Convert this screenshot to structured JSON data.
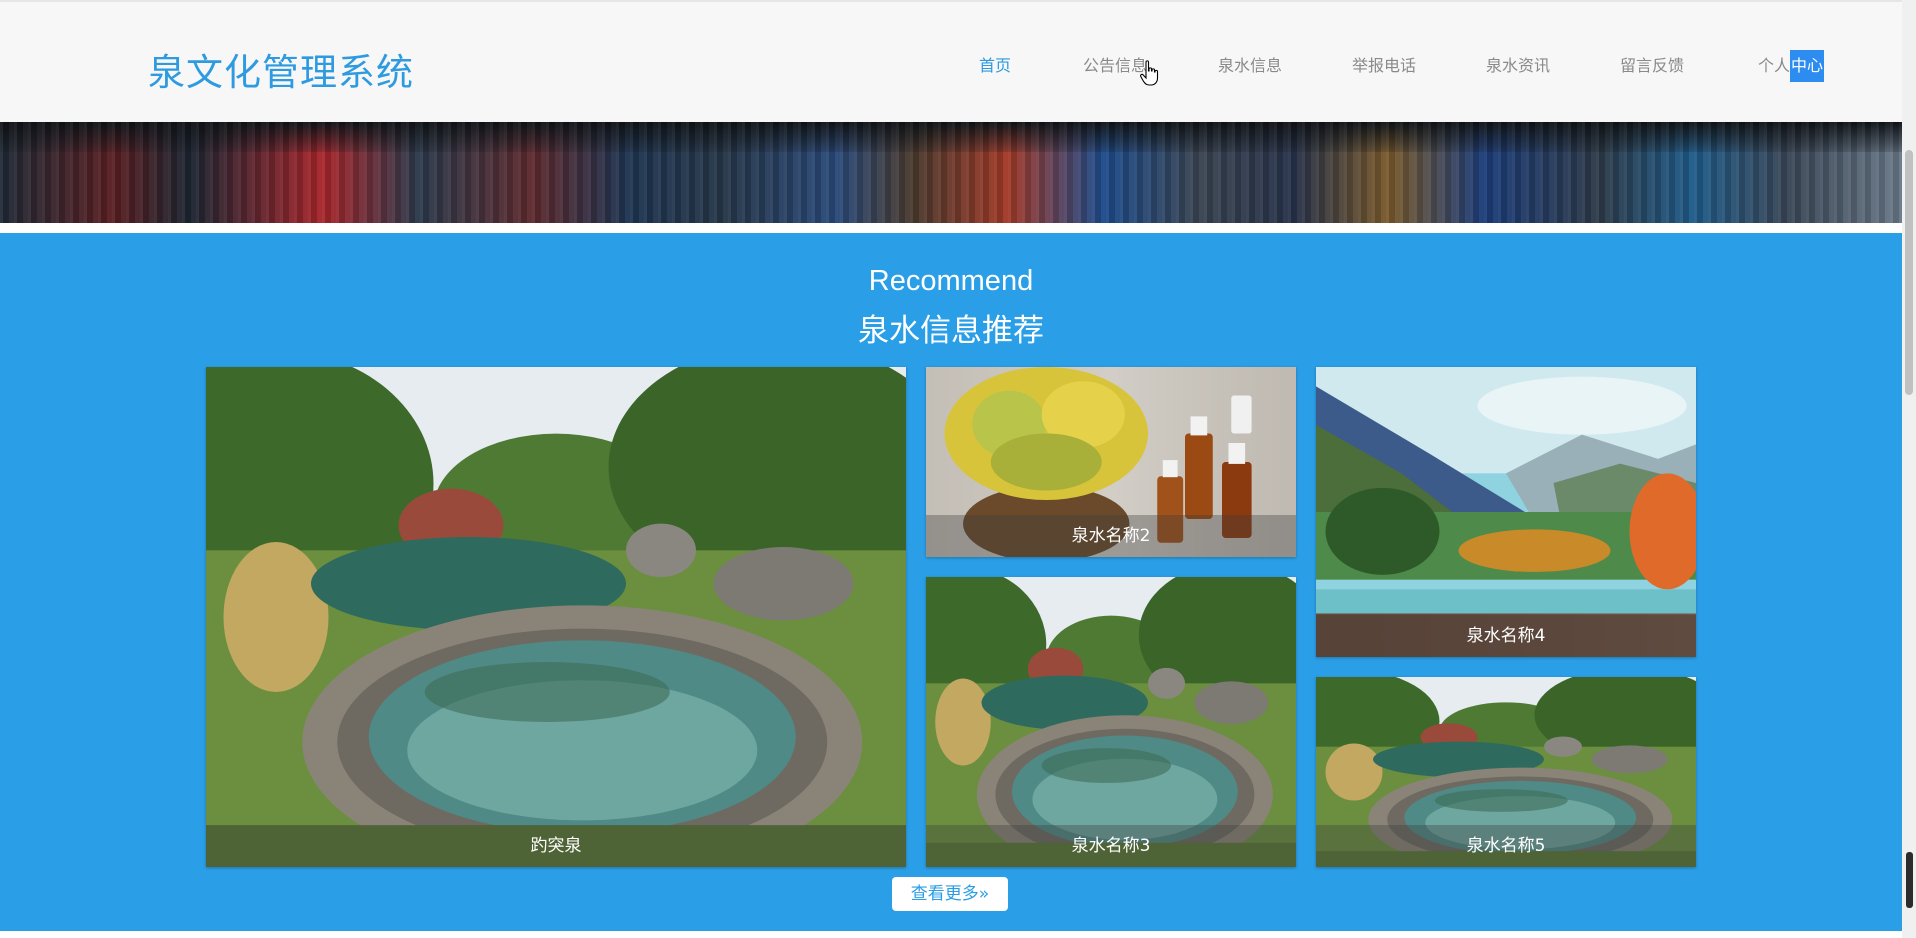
{
  "header": {
    "title": "泉文化管理系统",
    "nav": [
      {
        "label": "首页",
        "active": true
      },
      {
        "label": "公告信息"
      },
      {
        "label": "泉水信息"
      },
      {
        "label": "举报电话"
      },
      {
        "label": "泉水资讯"
      },
      {
        "label": "留言反馈"
      }
    ],
    "personal_prefix": "个人",
    "personal_highlight": "中心"
  },
  "recommend": {
    "title_en": "Recommend",
    "title_cn": "泉水信息推荐",
    "items": [
      {
        "name": "趵突泉",
        "image": "hot-spring-pool"
      },
      {
        "name": "泉水名称2",
        "image": "flower-basket-oil-bottles"
      },
      {
        "name": "泉水名称3",
        "image": "hot-spring-pool"
      },
      {
        "name": "泉水名称4",
        "image": "mountain-infinity-pool"
      },
      {
        "name": "泉水名称5",
        "image": "hot-spring-pool"
      }
    ],
    "more_label": "查看更多»"
  },
  "colors": {
    "accent": "#2e9ae0",
    "section_bg": "#2a9ee6",
    "header_bg": "#f7f7f7",
    "nav_text": "#8a8a8a",
    "highlight": "#2d8cf0"
  }
}
